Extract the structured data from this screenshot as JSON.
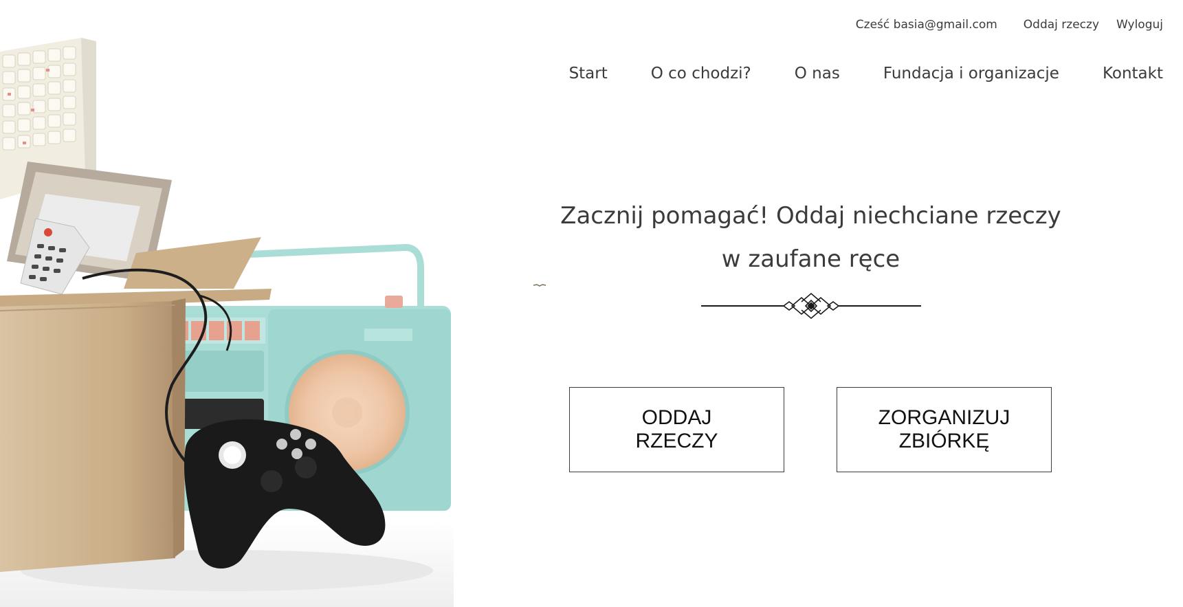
{
  "header": {
    "greeting": "Cześć basia@gmail.com",
    "give_things_link": "Oddaj rzeczy",
    "logout_link": "Wyloguj"
  },
  "nav": {
    "items": [
      {
        "label": "Start"
      },
      {
        "label": "O co chodzi?"
      },
      {
        "label": "O nas"
      },
      {
        "label": "Fundacja i organizacje"
      },
      {
        "label": "Kontakt"
      }
    ]
  },
  "hero": {
    "title": "Zacznij pomagać! Oddaj niechciane rzeczy w zaufane ręce",
    "buttons": {
      "give": "ODDAJ\nRZECZY",
      "organize": "ZORGANIZUJ\nZBIÓRKĘ"
    }
  },
  "icons": {
    "divider": "decorative-ornament-icon"
  },
  "colors": {
    "text": "#3b3b3b",
    "button_border": "#3b3b3b",
    "box": "#d8bf9c",
    "radio": "#a9ddd6",
    "speaker": "#f1cdb0",
    "gamepad": "#1a1a1a"
  }
}
